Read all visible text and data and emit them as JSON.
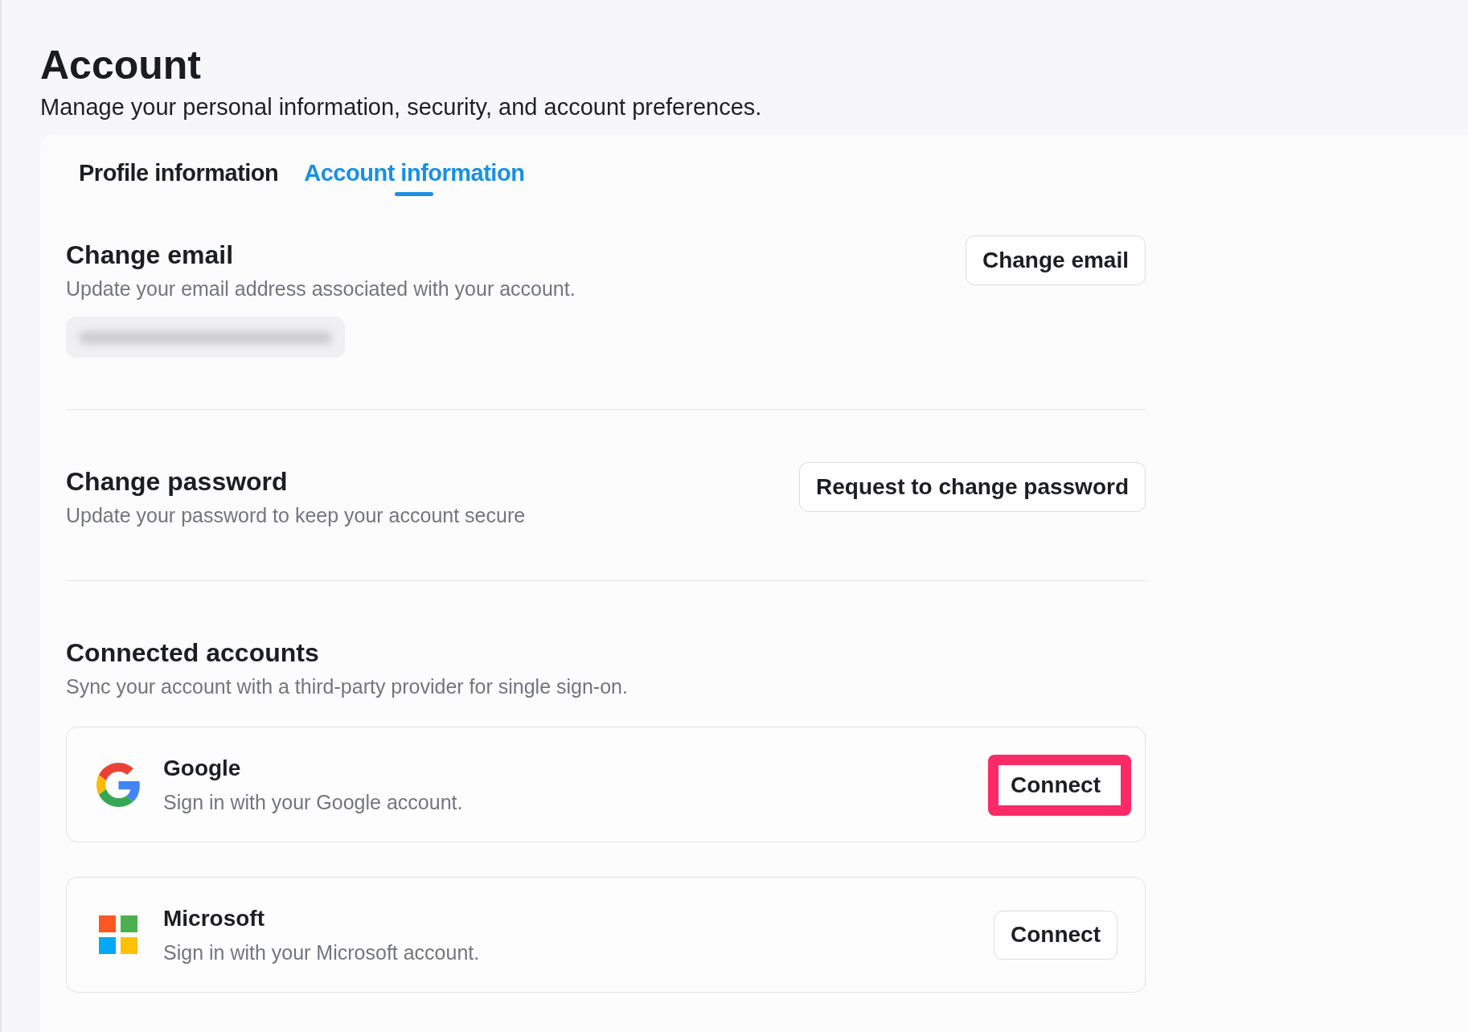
{
  "header": {
    "title": "Account",
    "subtitle": "Manage your personal information, security, and account preferences."
  },
  "tabs": [
    {
      "label": "Profile information",
      "selected": false
    },
    {
      "label": "Account information",
      "selected": true
    }
  ],
  "sections": [
    {
      "kind": "email",
      "title": "Change email",
      "description": "Update your email address associated with your account.",
      "button": "Change email"
    },
    {
      "kind": "password",
      "title": "Change password",
      "description": "Update your password to keep your account secure",
      "button": "Request to change password"
    },
    {
      "kind": "connections",
      "title": "Connected accounts",
      "description": "Sync your account with a third-party provider for single sign-on.",
      "accounts": [
        {
          "kind": "google",
          "name": "Google",
          "description": "Sign in with your Google account.",
          "button": "Connect",
          "highlighted": true
        },
        {
          "kind": "microsoft",
          "name": "Microsoft",
          "description": "Sign in with your Microsoft account.",
          "button": "Connect",
          "highlighted": false
        }
      ]
    }
  ]
}
